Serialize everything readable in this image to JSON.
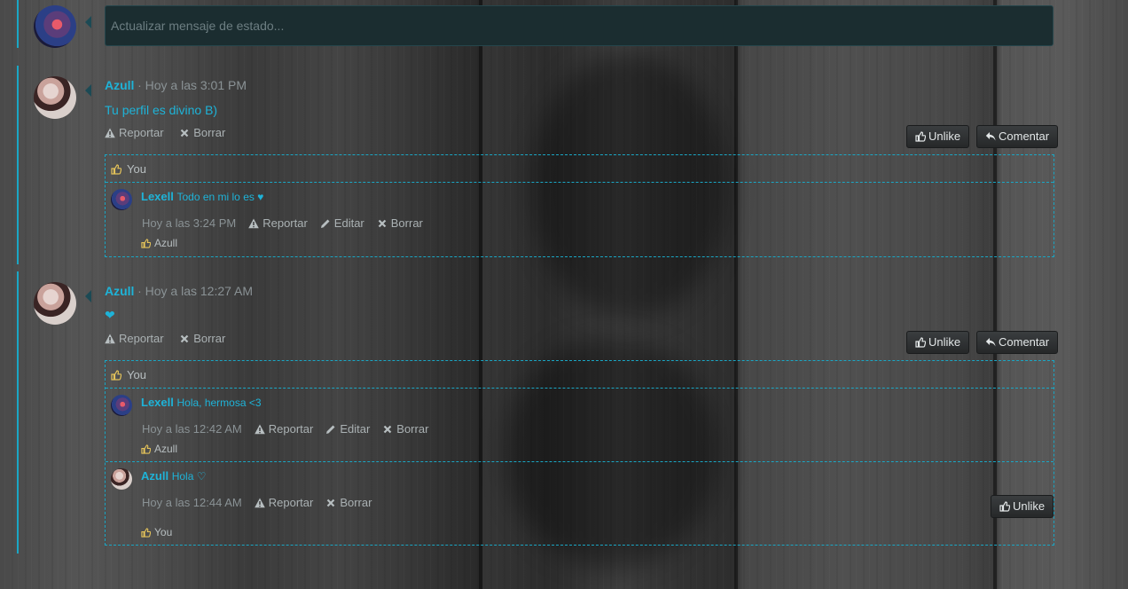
{
  "status": {
    "placeholder": "Actualizar mensaje de estado..."
  },
  "posts": [
    {
      "author": "Azull",
      "time": "· Hoy a las 3:01 PM",
      "message": "Tu perfil es divino B)",
      "actions": {
        "report": "Reportar",
        "delete": "Borrar"
      },
      "buttons": {
        "unlike": "Unlike",
        "comment": "Comentar"
      },
      "likes": "You",
      "comments": [
        {
          "author": "Lexell",
          "text": "Todo en mi lo es ♥",
          "time": "Hoy a las 3:24 PM",
          "actions": {
            "report": "Reportar",
            "edit": "Editar",
            "delete": "Borrar"
          },
          "likes": "Azull"
        }
      ]
    },
    {
      "author": "Azull",
      "time": "· Hoy a las 12:27 AM",
      "message": "❤",
      "actions": {
        "report": "Reportar",
        "delete": "Borrar"
      },
      "buttons": {
        "unlike": "Unlike",
        "comment": "Comentar"
      },
      "likes": "You",
      "comments": [
        {
          "author": "Lexell",
          "text": "Hola, hermosa <3",
          "time": "Hoy a las 12:42 AM",
          "actions": {
            "report": "Reportar",
            "edit": "Editar",
            "delete": "Borrar"
          },
          "likes": "Azull"
        },
        {
          "author": "Azull",
          "text": "Hola ♡",
          "time": "Hoy a las 12:44 AM",
          "actions": {
            "report": "Reportar",
            "delete": "Borrar"
          },
          "button": "Unlike",
          "likes": "You"
        }
      ]
    }
  ],
  "colors": {
    "accent": "#1eb3d8",
    "border": "#1aa7c5",
    "status_bg": "#1b2d30"
  }
}
